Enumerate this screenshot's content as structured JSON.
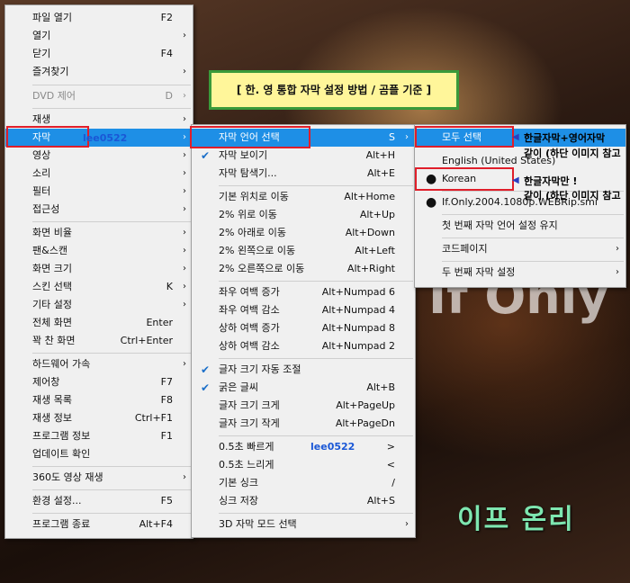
{
  "main_menu": {
    "items": [
      {
        "label": "파일 열기",
        "shortcut": "F2"
      },
      {
        "label": "열기",
        "arrow": "›"
      },
      {
        "label": "닫기",
        "shortcut": "F4"
      },
      {
        "label": "즐겨찾기",
        "arrow": "›"
      },
      {
        "label": "DVD 제어",
        "shortcut": "D",
        "arrow": "›"
      },
      {
        "label": "재생",
        "arrow": "›"
      },
      {
        "label": "자막",
        "arrow": "›"
      },
      {
        "label": "영상",
        "arrow": "›"
      },
      {
        "label": "소리",
        "arrow": "›"
      },
      {
        "label": "필터",
        "arrow": "›"
      },
      {
        "label": "접근성",
        "arrow": "›"
      },
      {
        "label": "화면 비율",
        "arrow": "›"
      },
      {
        "label": "팬&스캔",
        "arrow": "›"
      },
      {
        "label": "화면 크기",
        "arrow": "›"
      },
      {
        "label": "스킨 선택",
        "shortcut": "K",
        "arrow": "›"
      },
      {
        "label": "기타 설정",
        "arrow": "›"
      },
      {
        "label": "전체 화면",
        "shortcut": "Enter"
      },
      {
        "label": "꽉 찬 화면",
        "shortcut": "Ctrl+Enter"
      },
      {
        "label": "하드웨어 가속",
        "arrow": "›"
      },
      {
        "label": "제어창",
        "shortcut": "F7"
      },
      {
        "label": "재생 목록",
        "shortcut": "F8"
      },
      {
        "label": "재생 정보",
        "shortcut": "Ctrl+F1"
      },
      {
        "label": "프로그램 정보",
        "shortcut": "F1"
      },
      {
        "label": "업데이트 확인"
      },
      {
        "label": "360도 영상 재생",
        "arrow": "›"
      },
      {
        "label": "환경 설정...",
        "shortcut": "F5"
      },
      {
        "label": "프로그램 종료",
        "shortcut": "Alt+F4"
      }
    ]
  },
  "subtitle_menu": {
    "items": [
      {
        "label": "자막 언어 선택",
        "shortcut": "S",
        "arrow": "›"
      },
      {
        "label": "자막 보이기",
        "shortcut": "Alt+H",
        "check": "✔"
      },
      {
        "label": "자막 탐색기...",
        "shortcut": "Alt+E"
      },
      {
        "label": "기본 위치로 이동",
        "shortcut": "Alt+Home"
      },
      {
        "label": "2% 위로 이동",
        "shortcut": "Alt+Up"
      },
      {
        "label": "2% 아래로 이동",
        "shortcut": "Alt+Down"
      },
      {
        "label": "2% 왼쪽으로 이동",
        "shortcut": "Alt+Left"
      },
      {
        "label": "2% 오른쪽으로 이동",
        "shortcut": "Alt+Right"
      },
      {
        "label": "좌우 여백 증가",
        "shortcut": "Alt+Numpad 6"
      },
      {
        "label": "좌우 여백 감소",
        "shortcut": "Alt+Numpad 4"
      },
      {
        "label": "상하 여백 증가",
        "shortcut": "Alt+Numpad 8"
      },
      {
        "label": "상하 여백 감소",
        "shortcut": "Alt+Numpad 2"
      },
      {
        "label": "글자 크기 자동 조절",
        "check": "✔"
      },
      {
        "label": "굵은 글씨",
        "shortcut": "Alt+B",
        "check": "✔"
      },
      {
        "label": "글자 크기 크게",
        "shortcut": "Alt+PageUp"
      },
      {
        "label": "글자 크기 작게",
        "shortcut": "Alt+PageDn"
      },
      {
        "label": "0.5초 빠르게",
        "shortcut": ">"
      },
      {
        "label": "0.5초 느리게",
        "shortcut": "<"
      },
      {
        "label": "기본 싱크",
        "shortcut": "/"
      },
      {
        "label": "싱크 저장",
        "shortcut": "Alt+S"
      },
      {
        "label": "3D 자막 모드 선택",
        "arrow": "›"
      }
    ]
  },
  "language_menu": {
    "items": [
      {
        "label": "모두 선택"
      },
      {
        "label": "English (United States)"
      },
      {
        "label": "Korean",
        "bullet": "●"
      },
      {
        "label": "If.Only.2004.1080p.WEBRip.smi",
        "bullet": "●"
      },
      {
        "label": "첫 번째 자막 언어 설정 유지"
      },
      {
        "label": "코드페이지",
        "arrow": "›"
      },
      {
        "label": "두 번째 자막 설정",
        "arrow": "›"
      }
    ]
  },
  "annotations": {
    "title_box": "[ 한. 영 통합 자막 설정 방법 / 곰플 기준 ]",
    "watermark": "lee0522",
    "note_all_line1": "한글자막+영어자막",
    "note_all_line2": "같이 (하단 이미지 참고",
    "note_korean_line1": "한글자막만 !",
    "note_korean_line2": "같이 (하단 이미지 참고",
    "arrow": "◀",
    "video_subtitle": "이프 온리",
    "video_title_partial": "If Only"
  },
  "colors": {
    "highlight": "#1e8fe6",
    "annotation_red": "#e01e2a",
    "title_box_green": "#3a9a3a",
    "title_box_fill": "#fff69a",
    "watermark_blue": "#1a57d6",
    "subtitle_green": "#7ee6b0"
  }
}
